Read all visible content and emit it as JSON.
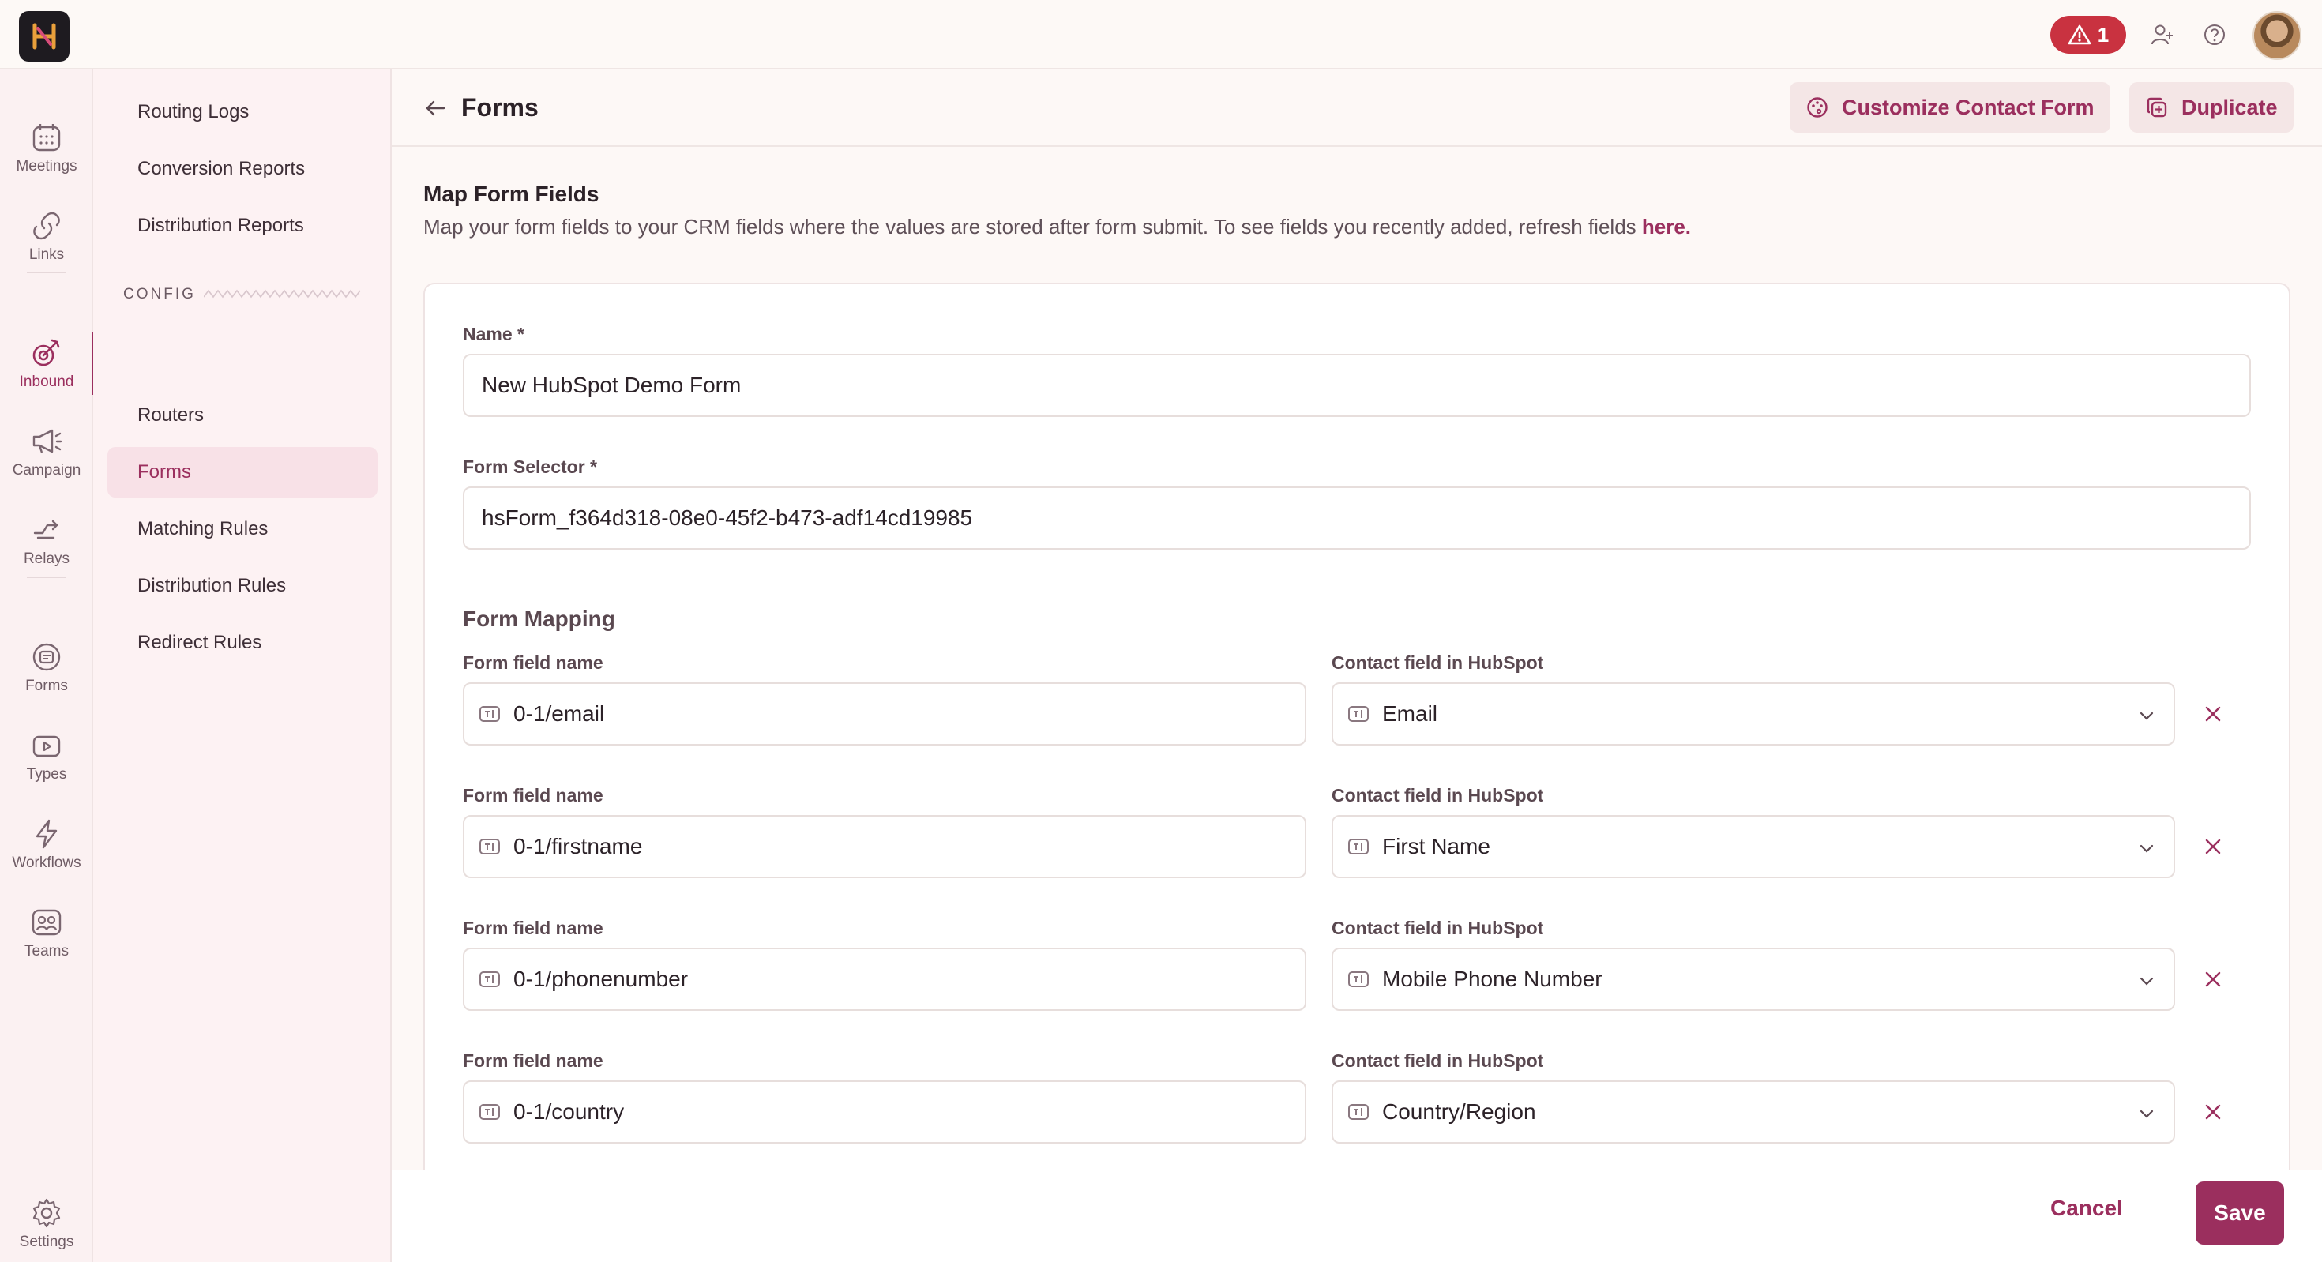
{
  "topbar": {
    "alert_count": "1"
  },
  "rail": {
    "items": [
      {
        "label": "Meetings",
        "icon": "calendar-icon"
      },
      {
        "label": "Links",
        "icon": "link-icon"
      },
      {
        "label": "Inbound",
        "icon": "inbound-icon"
      },
      {
        "label": "Campaign",
        "icon": "megaphone-icon"
      },
      {
        "label": "Relays",
        "icon": "relay-icon"
      },
      {
        "label": "Forms",
        "icon": "forms-icon"
      },
      {
        "label": "Types",
        "icon": "video-icon"
      },
      {
        "label": "Workflows",
        "icon": "lightning-icon"
      },
      {
        "label": "Teams",
        "icon": "teams-icon"
      },
      {
        "label": "Settings",
        "icon": "gear-icon"
      }
    ]
  },
  "subnav": {
    "items_top": [
      "Routing Logs",
      "Conversion Reports",
      "Distribution Reports"
    ],
    "config_heading": "CONFIG",
    "items_config": [
      "Routers",
      "Forms",
      "Matching Rules",
      "Distribution Rules",
      "Redirect Rules"
    ]
  },
  "header": {
    "title": "Forms",
    "customize_label": "Customize Contact Form",
    "duplicate_label": "Duplicate"
  },
  "section": {
    "title": "Map Form Fields",
    "description": "Map your form fields to your CRM fields where the values are stored after form submit. To see fields you recently added, refresh fields",
    "link_text": "here."
  },
  "form": {
    "name_label": "Name *",
    "name_value": "New HubSpot Demo Form",
    "selector_label": "Form Selector *",
    "selector_value": "hsForm_f364d318-08e0-45f2-b473-adf14cd19985",
    "mapping_title": "Form Mapping",
    "mappings": [
      {
        "field_label": "Form field name",
        "field_value": "0-1/email",
        "crm_label": "Contact field in HubSpot",
        "crm_value": "Email"
      },
      {
        "field_label": "Form field name",
        "field_value": "0-1/firstname",
        "crm_label": "Contact field in HubSpot",
        "crm_value": "First Name"
      },
      {
        "field_label": "Form field name",
        "field_value": "0-1/phonenumber",
        "crm_label": "Contact field in HubSpot",
        "crm_value": "Mobile Phone Number"
      },
      {
        "field_label": "Form field name",
        "field_value": "0-1/country",
        "crm_label": "Contact field in HubSpot",
        "crm_value": "Country/Region"
      }
    ]
  },
  "footer": {
    "cancel_label": "Cancel",
    "save_label": "Save"
  },
  "colors": {
    "accent": "#9b2f5e",
    "alert": "#c93240"
  }
}
